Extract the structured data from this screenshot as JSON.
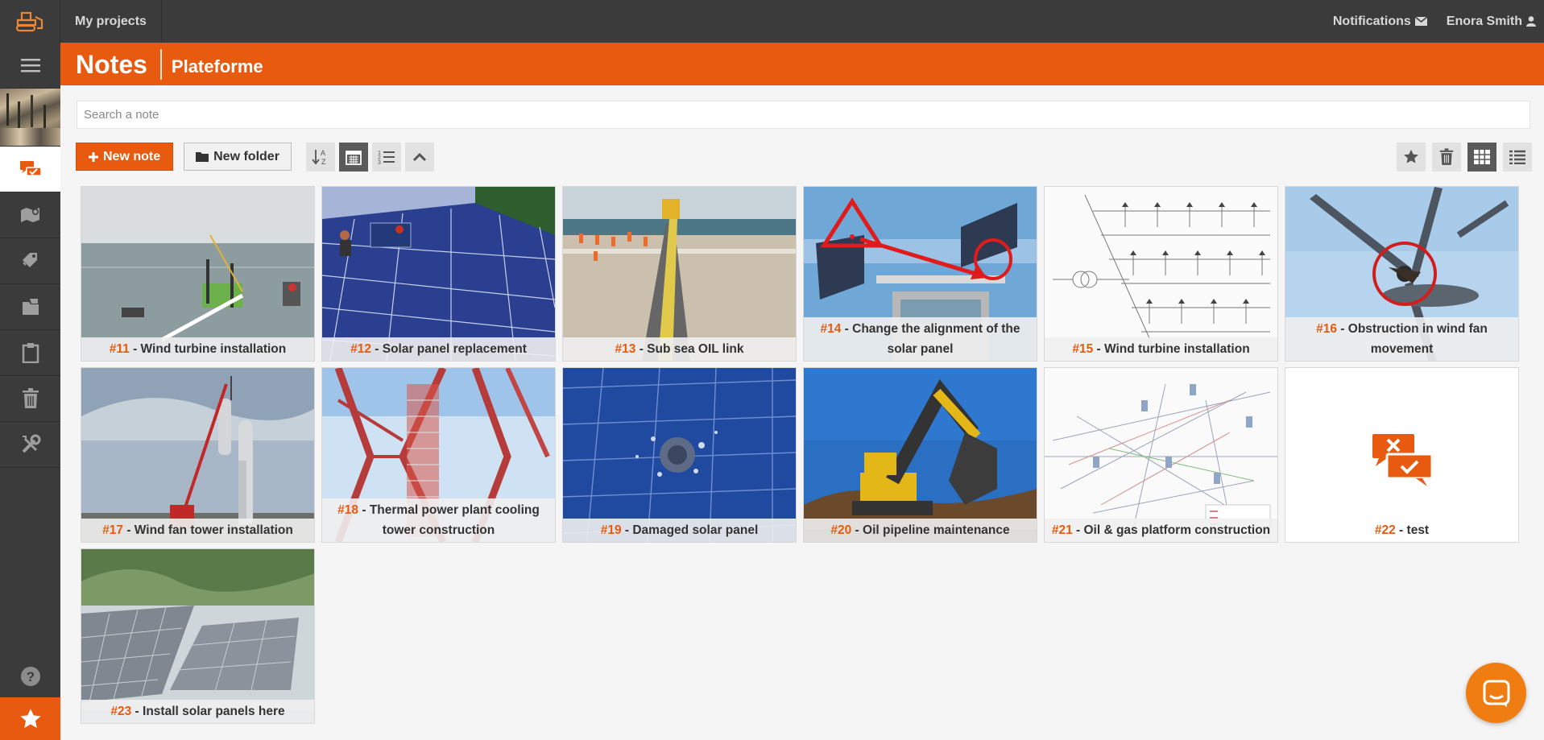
{
  "topbar": {
    "my_projects": "My projects",
    "notifications": "Notifications",
    "user_name": "Enora Smith"
  },
  "header": {
    "title": "Notes",
    "subtitle": "Plateforme"
  },
  "search": {
    "placeholder": "Search a note",
    "value": ""
  },
  "toolbar": {
    "new_note": "New note",
    "new_folder": "New folder"
  },
  "colors": {
    "accent": "#e85a0f",
    "topbar": "#3b3b3b"
  },
  "notes": [
    {
      "number": "#11",
      "sep": " - ",
      "title": "Wind turbine installation"
    },
    {
      "number": "#12",
      "sep": " - ",
      "title": "Solar panel replacement"
    },
    {
      "number": "#13",
      "sep": " - ",
      "title": "Sub sea OIL link"
    },
    {
      "number": "#14",
      "sep": " - ",
      "title": "Change the alignment of the solar panel"
    },
    {
      "number": "#15",
      "sep": " - ",
      "title": "Wind turbine installation"
    },
    {
      "number": "#16",
      "sep": " - ",
      "title": "Obstruction in wind fan movement"
    },
    {
      "number": "#17",
      "sep": " - ",
      "title": "Wind fan tower installation"
    },
    {
      "number": "#18",
      "sep": " - ",
      "title": "Thermal power plant cooling tower construction"
    },
    {
      "number": "#19",
      "sep": " - ",
      "title": "Damaged solar panel"
    },
    {
      "number": "#20",
      "sep": " - ",
      "title": "Oil pipeline maintenance"
    },
    {
      "number": "#21",
      "sep": " - ",
      "title": "Oil & gas platform construction"
    },
    {
      "number": "#22",
      "sep": " - ",
      "title": "test"
    },
    {
      "number": "#23",
      "sep": " - ",
      "title": "Install solar panels here"
    }
  ]
}
